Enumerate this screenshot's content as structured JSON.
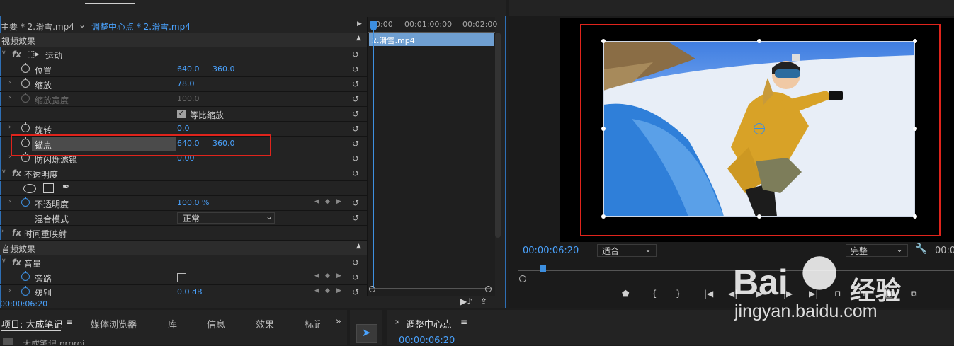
{
  "effect_controls": {
    "master_clip": "主要 * 2.滑雪.mp4",
    "sequence_clip": "调整中心点 * 2.滑雪.mp4",
    "video_effects_header": "视频效果",
    "motion": {
      "label": "运动",
      "position": {
        "label": "位置",
        "x": "640.0",
        "y": "360.0"
      },
      "scale": {
        "label": "缩放",
        "value": "78.0"
      },
      "scale_width": {
        "label": "缩放宽度",
        "value": "100.0"
      },
      "uniform_scale": {
        "label": "等比缩放",
        "checked": true
      },
      "rotation": {
        "label": "旋转",
        "value": "0.0"
      },
      "anchor": {
        "label": "锚点",
        "x": "640.0",
        "y": "360.0"
      },
      "anti_flicker": {
        "label": "防闪烁滤镜",
        "value": "0.00"
      }
    },
    "opacity": {
      "label": "不透明度",
      "param_label": "不透明度",
      "value": "100.0 %",
      "blend_label": "混合模式",
      "blend_value": "正常"
    },
    "time_remap": "时间重映射",
    "audio_effects_header": "音频效果",
    "volume": {
      "label": "音量",
      "bypass": "旁路",
      "level_label": "级别",
      "level_value": "0.0 dB"
    },
    "timeline": {
      "times": [
        "00:00",
        "00:01:00:00",
        "00:02:00"
      ],
      "clip_label": "2.滑雪.mp4"
    },
    "current_time": "00:00:06:20"
  },
  "program_monitor": {
    "timecode": "00:00:06:20",
    "fit_value": "适合",
    "quality_value": "完整",
    "timecode_right": "00:0"
  },
  "bottom_panels": {
    "project_tabs": [
      "项目: 大成笔记",
      "媒体浏览器",
      "库",
      "信息",
      "效果",
      "标记"
    ],
    "project_file": "大成笔记.prproj",
    "timeline_tab": "调整中心点",
    "timeline_timecode": "00:00:06:20"
  },
  "watermark": {
    "brand": "Bai",
    "brand_suffix": "经验",
    "url": "jingyan.baidu.com"
  },
  "colors": {
    "accent_blue": "#4aa3ff",
    "highlight_red": "#e0241c",
    "clip_blue": "#6f9fd1"
  }
}
